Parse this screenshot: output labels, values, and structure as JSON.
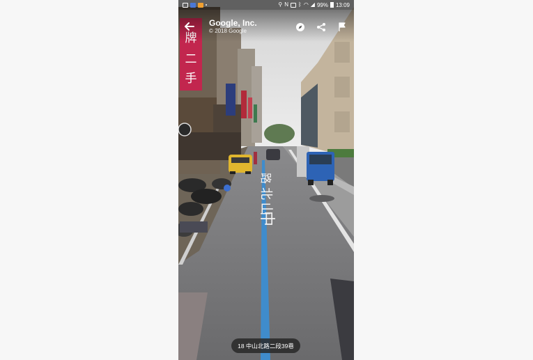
{
  "status_bar": {
    "battery": "99%",
    "time": "13:09",
    "left_icons": [
      "gallery-icon",
      "app-icon",
      "notification-icon",
      "dot-icon"
    ],
    "right_icons": [
      "location-icon",
      "nfc-icon",
      "vibrate-icon",
      "bluetooth-icon",
      "wifi-icon",
      "signal-icon",
      "battery-icon"
    ]
  },
  "header": {
    "title": "Google, Inc.",
    "subtitle": "© 2018 Google"
  },
  "toolbar": {
    "icons": [
      "back-arrow-icon",
      "compass-icon",
      "share-icon",
      "flag-icon"
    ]
  },
  "road_marking": "中山北路",
  "location": {
    "address": "18 中山北路二段39巷"
  },
  "colors": {
    "sky": "#e2e2e2",
    "road": "#707072",
    "lane_blue": "#3f8ccc",
    "building_right": "#c3b49d",
    "sign_red": "#c2264e"
  }
}
